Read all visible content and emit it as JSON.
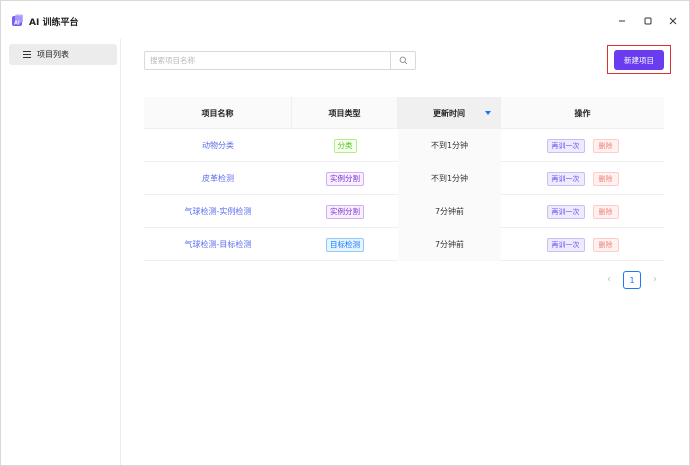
{
  "app": {
    "title": "AI 训练平台",
    "logo_icon": "app-logo-icon",
    "brand_color": "#6a3cf0"
  },
  "window_controls": [
    "minimize-icon",
    "maximize-icon",
    "close-icon"
  ],
  "sidebar": {
    "items": [
      {
        "label": "项目列表",
        "icon": "menu-icon",
        "active": true
      }
    ]
  },
  "search": {
    "placeholder": "搜索项目名称",
    "value": "",
    "icon": "search-icon"
  },
  "toolbar": {
    "new_label": "新建项目",
    "highlight_color": "#e0302a"
  },
  "table": {
    "columns": [
      "项目名称",
      "项目类型",
      "更新时间",
      "操作"
    ],
    "sorted_column": "更新时间",
    "rows": [
      {
        "name": "动物分类",
        "type": "分类",
        "type_color": "green",
        "updated": "不到1分钟",
        "retrain": "再训一次",
        "delete": "删除"
      },
      {
        "name": "皮革检测",
        "type": "实例分割",
        "type_color": "purple",
        "updated": "不到1分钟",
        "retrain": "再训一次",
        "delete": "删除"
      },
      {
        "name": "气球检测-实例检测",
        "type": "实例分割",
        "type_color": "purple",
        "updated": "7分钟前",
        "retrain": "再训一次",
        "delete": "删除"
      },
      {
        "name": "气球检测-目标检测",
        "type": "目标检测",
        "type_color": "blue",
        "updated": "7分钟前",
        "retrain": "再训一次",
        "delete": "删除"
      }
    ]
  },
  "pagination": {
    "current_page": "1",
    "prev_icon": "chevron-left-icon",
    "next_icon": "chevron-right-icon"
  }
}
